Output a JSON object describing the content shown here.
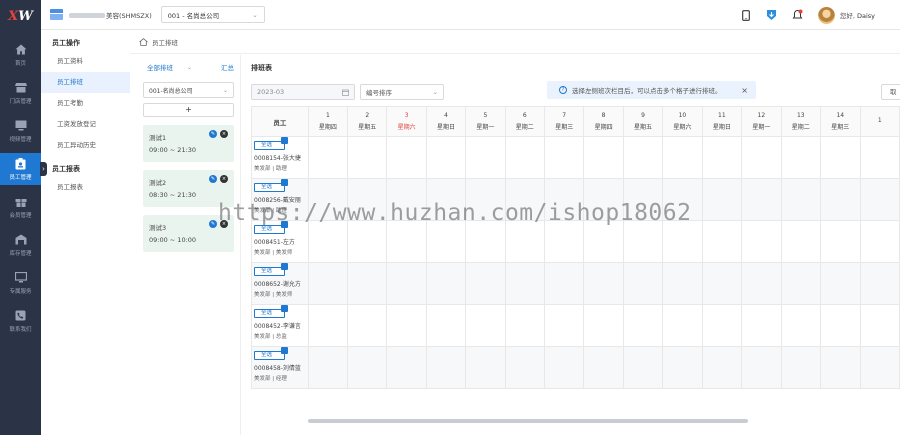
{
  "logo": {
    "x": "X",
    "w": "W"
  },
  "sidebar": {
    "items": [
      {
        "label": "首页",
        "icon": "home-icon"
      },
      {
        "label": "门店管理",
        "icon": "store-icon"
      },
      {
        "label": "视频管理",
        "icon": "monitor-icon"
      },
      {
        "label": "员工管理",
        "icon": "badge-icon",
        "active": true
      },
      {
        "label": "会员管理",
        "icon": "gift-icon"
      },
      {
        "label": "库存管理",
        "icon": "warehouse-icon"
      },
      {
        "label": "专属服务",
        "icon": "display-icon"
      },
      {
        "label": "联系我们",
        "icon": "phone-icon"
      }
    ]
  },
  "header": {
    "store_name": "美容(SHMSZX)",
    "company": "001 - 名尚总公司",
    "greeting": "您好,",
    "user": "Daisy"
  },
  "subnav": {
    "groups": [
      {
        "title": "员工操作",
        "items": [
          {
            "label": "员工资料"
          },
          {
            "label": "员工排班",
            "active": true
          },
          {
            "label": "员工考勤"
          },
          {
            "label": "工资发放登记"
          },
          {
            "label": "员工异动历史"
          }
        ]
      },
      {
        "title": "员工报表",
        "items": [
          {
            "label": "员工报表"
          }
        ]
      }
    ]
  },
  "breadcrumb": "员工排班",
  "shift_panel": {
    "filter": "全部排班",
    "summary": "汇总",
    "company": "001-名尚总公司",
    "add": "+",
    "shifts": [
      {
        "name": "测试1",
        "time": "09:00 ~ 21:30"
      },
      {
        "name": "测试2",
        "time": "08:30 ~ 21:30"
      },
      {
        "name": "测试3",
        "time": "09:00 ~ 10:00"
      }
    ]
  },
  "roster": {
    "title": "排班表",
    "month": "2023-03",
    "sort": "编号排序",
    "tip": "选择左侧班次栏目后，可以点击多个格子进行排班。",
    "right_button": "取",
    "employee_header": "员工",
    "all_label": "全选",
    "days": [
      {
        "n": "1",
        "w": "星期四"
      },
      {
        "n": "2",
        "w": "星期五"
      },
      {
        "n": "3",
        "w": "星期六",
        "weekend": true
      },
      {
        "n": "4",
        "w": "星期日"
      },
      {
        "n": "5",
        "w": "星期一"
      },
      {
        "n": "6",
        "w": "星期二"
      },
      {
        "n": "7",
        "w": "星期三"
      },
      {
        "n": "8",
        "w": "星期四"
      },
      {
        "n": "9",
        "w": "星期五"
      },
      {
        "n": "10",
        "w": "星期六"
      },
      {
        "n": "11",
        "w": "星期日"
      },
      {
        "n": "12",
        "w": "星期一"
      },
      {
        "n": "13",
        "w": "星期二"
      },
      {
        "n": "14",
        "w": "星期三"
      },
      {
        "n": "1",
        "w": ""
      }
    ],
    "employees": [
      {
        "name": "0008154-张大捷",
        "dept": "美发部 | 助理"
      },
      {
        "name": "0008256-戴安丽",
        "dept": "美发部 | 助理"
      },
      {
        "name": "0008451-左方",
        "dept": "美发部 | 美发师"
      },
      {
        "name": "0008652-谢允方",
        "dept": "美发部 | 美发师"
      },
      {
        "name": "0008452-李谦言",
        "dept": "美发部 | 总监"
      },
      {
        "name": "0008458-刘倩蓝",
        "dept": "美发部 | 经理"
      }
    ]
  },
  "watermark": "https://www.huzhan.com/ishop18062",
  "colors": {
    "sidebar": "#2b3347",
    "accent": "#1f78d1",
    "weekend": "#e0443b"
  }
}
